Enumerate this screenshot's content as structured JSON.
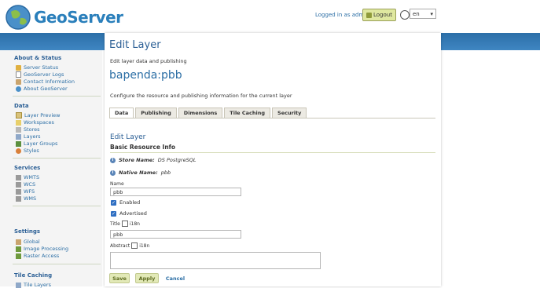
{
  "header": {
    "logo_text": "GeoServer",
    "login_text": "Logged in as admin.",
    "logout_label": "Logout",
    "language_value": "en"
  },
  "sidebar": {
    "sections": [
      {
        "title": "About & Status",
        "items": [
          {
            "label": "Server Status",
            "icon": "server-status-icon"
          },
          {
            "label": "GeoServer Logs",
            "icon": "logs-icon"
          },
          {
            "label": "Contact Information",
            "icon": "contact-icon"
          },
          {
            "label": "About GeoServer",
            "icon": "about-icon"
          }
        ]
      },
      {
        "title": "Data",
        "items": [
          {
            "label": "Layer Preview",
            "icon": "layer-preview-icon"
          },
          {
            "label": "Workspaces",
            "icon": "workspaces-icon"
          },
          {
            "label": "Stores",
            "icon": "stores-icon"
          },
          {
            "label": "Layers",
            "icon": "layers-icon"
          },
          {
            "label": "Layer Groups",
            "icon": "layer-groups-icon"
          },
          {
            "label": "Styles",
            "icon": "styles-icon"
          }
        ]
      },
      {
        "title": "Services",
        "items": [
          {
            "label": "WMTS",
            "icon": "wmts-icon"
          },
          {
            "label": "WCS",
            "icon": "wcs-icon"
          },
          {
            "label": "WFS",
            "icon": "wfs-icon"
          },
          {
            "label": "WMS",
            "icon": "wms-icon"
          }
        ]
      },
      {
        "title": "Settings",
        "items": [
          {
            "label": "Global",
            "icon": "global-icon"
          },
          {
            "label": "Image Processing",
            "icon": "image-processing-icon"
          },
          {
            "label": "Raster Access",
            "icon": "raster-access-icon"
          }
        ]
      },
      {
        "title": "Tile Caching",
        "items": [
          {
            "label": "Tile Layers",
            "icon": "tile-layers-icon"
          }
        ]
      }
    ]
  },
  "main": {
    "title": "Edit Layer",
    "subtitle": "Edit layer data and publishing",
    "layer_name": "bapenda:pbb",
    "description": "Configure the resource and publishing information for the current layer",
    "tabs": [
      "Data",
      "Publishing",
      "Dimensions",
      "Tile Caching",
      "Security"
    ],
    "section_title": "Edit Layer",
    "sub_heading": "Basic Resource Info",
    "store_name_label": "Store Name:",
    "store_name_value": "DS PostgreSQL",
    "native_name_label": "Native Name:",
    "native_name_value": "pbb",
    "name_label": "Name",
    "name_value": "pbb",
    "enabled_label": "Enabled",
    "advertised_label": "Advertised",
    "title_label": "Title",
    "i18n_label": "i18n",
    "title_value": "pbb",
    "abstract_label": "Abstract",
    "save_label": "Save",
    "apply_label": "Apply",
    "cancel_label": "Cancel"
  },
  "colors": {
    "banner": "#2c6fa8",
    "link": "#2b6ea5",
    "button": "#e2e9b7"
  }
}
